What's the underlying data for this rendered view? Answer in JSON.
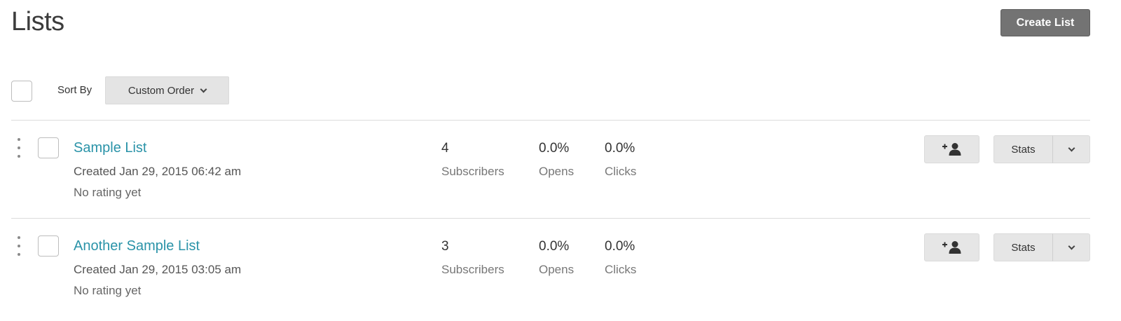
{
  "page": {
    "title": "Lists",
    "create_button": "Create List"
  },
  "toolbar": {
    "sort_label": "Sort By",
    "sort_value": "Custom Order"
  },
  "lists": [
    {
      "name": "Sample List",
      "created": "Created Jan 29, 2015 06:42 am",
      "rating": "No rating yet",
      "subscribers": "4",
      "subscribers_label": "Subscribers",
      "opens": "0.0%",
      "opens_label": "Opens",
      "clicks": "0.0%",
      "clicks_label": "Clicks",
      "stats_button": "Stats"
    },
    {
      "name": "Another Sample List",
      "created": "Created Jan 29, 2015 03:05 am",
      "rating": "No rating yet",
      "subscribers": "3",
      "subscribers_label": "Subscribers",
      "opens": "0.0%",
      "opens_label": "Opens",
      "clicks": "0.0%",
      "clicks_label": "Clicks",
      "stats_button": "Stats"
    }
  ],
  "icons": {
    "add_subscriber": "add-user-icon",
    "drag": "drag-handle-icon",
    "dropdown": "chevron-down-icon"
  },
  "colors": {
    "link": "#2a93a8",
    "primary_button": "#737373",
    "secondary_button": "#e6e6e6"
  }
}
